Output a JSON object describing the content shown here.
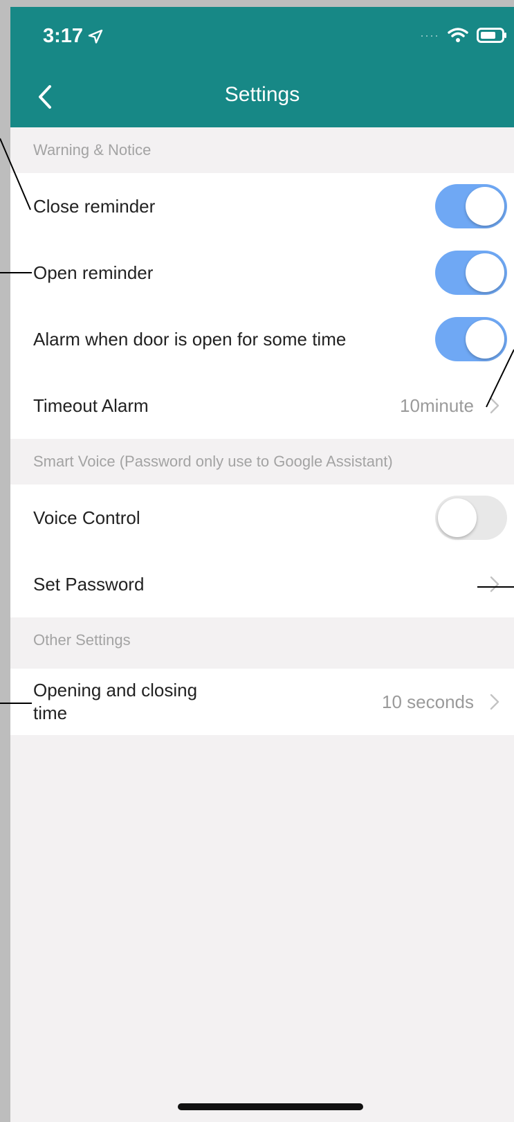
{
  "status_bar": {
    "time": "3:17"
  },
  "nav": {
    "title": "Settings"
  },
  "sections": {
    "warning": {
      "header": "Warning & Notice",
      "close_reminder": {
        "label": "Close reminder",
        "on": true
      },
      "open_reminder": {
        "label": "Open reminder",
        "on": true
      },
      "door_open_alarm": {
        "label": "Alarm when door is open for some time",
        "on": true
      },
      "timeout_alarm": {
        "label": "Timeout Alarm",
        "value": "10minute"
      }
    },
    "smart_voice": {
      "header": "Smart Voice (Password only use to Google Assistant)",
      "voice_control": {
        "label": "Voice Control",
        "on": false
      },
      "set_password": {
        "label": "Set Password"
      }
    },
    "other": {
      "header": "Other Settings",
      "open_close_time": {
        "label_line1": "Opening and closing",
        "label_line2": "time",
        "value": "10 seconds"
      }
    }
  },
  "colors": {
    "header_bg": "#178886",
    "toggle_on": "#6fa8f4",
    "toggle_off": "#e8e8e8",
    "page_bg": "#f3f1f2"
  },
  "icons": [
    "location-arrow-icon",
    "signal-dots-icon",
    "wifi-icon",
    "battery-icon",
    "back-chevron-icon",
    "chevron-right-icon"
  ]
}
